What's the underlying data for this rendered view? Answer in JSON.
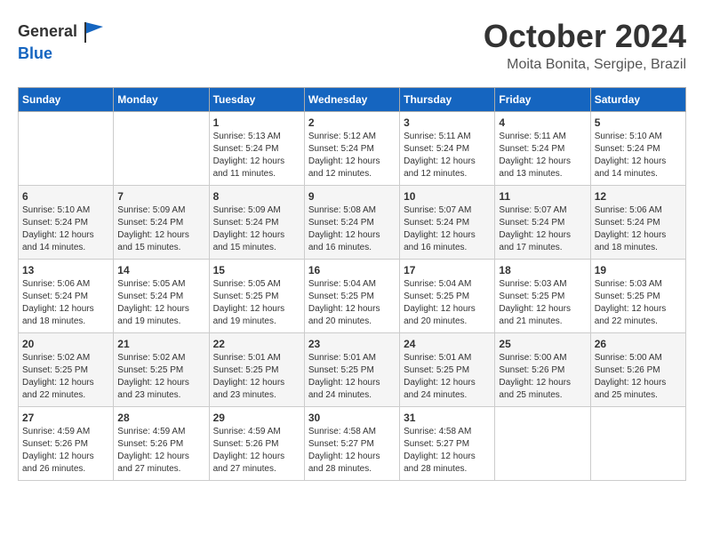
{
  "header": {
    "logo_general": "General",
    "logo_blue": "Blue",
    "month": "October 2024",
    "location": "Moita Bonita, Sergipe, Brazil"
  },
  "calendar": {
    "days_of_week": [
      "Sunday",
      "Monday",
      "Tuesday",
      "Wednesday",
      "Thursday",
      "Friday",
      "Saturday"
    ],
    "weeks": [
      [
        {
          "day": "",
          "info": ""
        },
        {
          "day": "",
          "info": ""
        },
        {
          "day": "1",
          "info": "Sunrise: 5:13 AM\nSunset: 5:24 PM\nDaylight: 12 hours\nand 11 minutes."
        },
        {
          "day": "2",
          "info": "Sunrise: 5:12 AM\nSunset: 5:24 PM\nDaylight: 12 hours\nand 12 minutes."
        },
        {
          "day": "3",
          "info": "Sunrise: 5:11 AM\nSunset: 5:24 PM\nDaylight: 12 hours\nand 12 minutes."
        },
        {
          "day": "4",
          "info": "Sunrise: 5:11 AM\nSunset: 5:24 PM\nDaylight: 12 hours\nand 13 minutes."
        },
        {
          "day": "5",
          "info": "Sunrise: 5:10 AM\nSunset: 5:24 PM\nDaylight: 12 hours\nand 14 minutes."
        }
      ],
      [
        {
          "day": "6",
          "info": "Sunrise: 5:10 AM\nSunset: 5:24 PM\nDaylight: 12 hours\nand 14 minutes."
        },
        {
          "day": "7",
          "info": "Sunrise: 5:09 AM\nSunset: 5:24 PM\nDaylight: 12 hours\nand 15 minutes."
        },
        {
          "day": "8",
          "info": "Sunrise: 5:09 AM\nSunset: 5:24 PM\nDaylight: 12 hours\nand 15 minutes."
        },
        {
          "day": "9",
          "info": "Sunrise: 5:08 AM\nSunset: 5:24 PM\nDaylight: 12 hours\nand 16 minutes."
        },
        {
          "day": "10",
          "info": "Sunrise: 5:07 AM\nSunset: 5:24 PM\nDaylight: 12 hours\nand 16 minutes."
        },
        {
          "day": "11",
          "info": "Sunrise: 5:07 AM\nSunset: 5:24 PM\nDaylight: 12 hours\nand 17 minutes."
        },
        {
          "day": "12",
          "info": "Sunrise: 5:06 AM\nSunset: 5:24 PM\nDaylight: 12 hours\nand 18 minutes."
        }
      ],
      [
        {
          "day": "13",
          "info": "Sunrise: 5:06 AM\nSunset: 5:24 PM\nDaylight: 12 hours\nand 18 minutes."
        },
        {
          "day": "14",
          "info": "Sunrise: 5:05 AM\nSunset: 5:24 PM\nDaylight: 12 hours\nand 19 minutes."
        },
        {
          "day": "15",
          "info": "Sunrise: 5:05 AM\nSunset: 5:25 PM\nDaylight: 12 hours\nand 19 minutes."
        },
        {
          "day": "16",
          "info": "Sunrise: 5:04 AM\nSunset: 5:25 PM\nDaylight: 12 hours\nand 20 minutes."
        },
        {
          "day": "17",
          "info": "Sunrise: 5:04 AM\nSunset: 5:25 PM\nDaylight: 12 hours\nand 20 minutes."
        },
        {
          "day": "18",
          "info": "Sunrise: 5:03 AM\nSunset: 5:25 PM\nDaylight: 12 hours\nand 21 minutes."
        },
        {
          "day": "19",
          "info": "Sunrise: 5:03 AM\nSunset: 5:25 PM\nDaylight: 12 hours\nand 22 minutes."
        }
      ],
      [
        {
          "day": "20",
          "info": "Sunrise: 5:02 AM\nSunset: 5:25 PM\nDaylight: 12 hours\nand 22 minutes."
        },
        {
          "day": "21",
          "info": "Sunrise: 5:02 AM\nSunset: 5:25 PM\nDaylight: 12 hours\nand 23 minutes."
        },
        {
          "day": "22",
          "info": "Sunrise: 5:01 AM\nSunset: 5:25 PM\nDaylight: 12 hours\nand 23 minutes."
        },
        {
          "day": "23",
          "info": "Sunrise: 5:01 AM\nSunset: 5:25 PM\nDaylight: 12 hours\nand 24 minutes."
        },
        {
          "day": "24",
          "info": "Sunrise: 5:01 AM\nSunset: 5:25 PM\nDaylight: 12 hours\nand 24 minutes."
        },
        {
          "day": "25",
          "info": "Sunrise: 5:00 AM\nSunset: 5:26 PM\nDaylight: 12 hours\nand 25 minutes."
        },
        {
          "day": "26",
          "info": "Sunrise: 5:00 AM\nSunset: 5:26 PM\nDaylight: 12 hours\nand 25 minutes."
        }
      ],
      [
        {
          "day": "27",
          "info": "Sunrise: 4:59 AM\nSunset: 5:26 PM\nDaylight: 12 hours\nand 26 minutes."
        },
        {
          "day": "28",
          "info": "Sunrise: 4:59 AM\nSunset: 5:26 PM\nDaylight: 12 hours\nand 27 minutes."
        },
        {
          "day": "29",
          "info": "Sunrise: 4:59 AM\nSunset: 5:26 PM\nDaylight: 12 hours\nand 27 minutes."
        },
        {
          "day": "30",
          "info": "Sunrise: 4:58 AM\nSunset: 5:27 PM\nDaylight: 12 hours\nand 28 minutes."
        },
        {
          "day": "31",
          "info": "Sunrise: 4:58 AM\nSunset: 5:27 PM\nDaylight: 12 hours\nand 28 minutes."
        },
        {
          "day": "",
          "info": ""
        },
        {
          "day": "",
          "info": ""
        }
      ]
    ]
  }
}
